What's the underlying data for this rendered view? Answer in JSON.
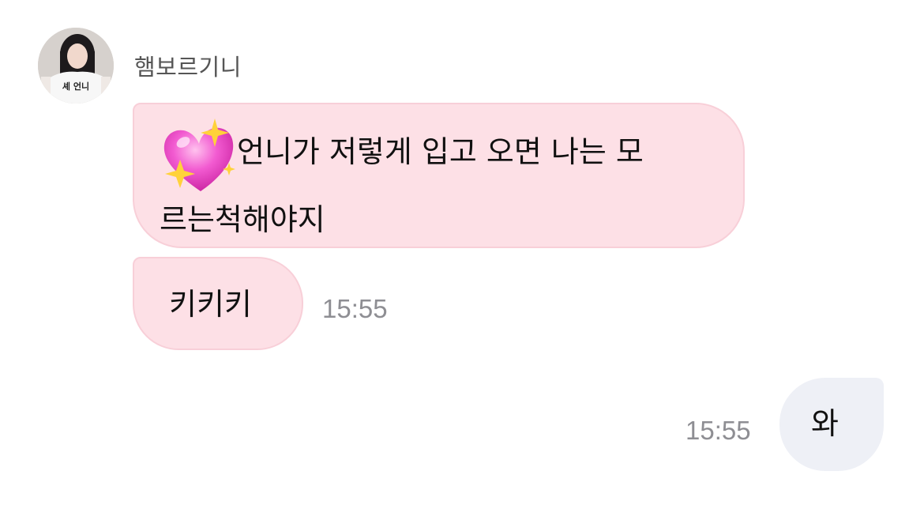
{
  "conversation": {
    "sender": {
      "name": "햄보르기니",
      "avatar_shirt_text": "셰 언니"
    },
    "messages": [
      {
        "from": "other",
        "emoji": "sparkling-heart-icon",
        "line1": "언니가 저렇게 입고 오면 나는 모",
        "line2": "르는척해야지"
      },
      {
        "from": "other",
        "text": "키키키",
        "time": "15:55"
      },
      {
        "from": "me",
        "text": "와",
        "time": "15:55"
      }
    ]
  },
  "colors": {
    "incoming_bubble": "#fde0e6",
    "incoming_border": "#f8cfd8",
    "outgoing_bubble": "#eef0f6",
    "timestamp": "#8e8e93"
  }
}
